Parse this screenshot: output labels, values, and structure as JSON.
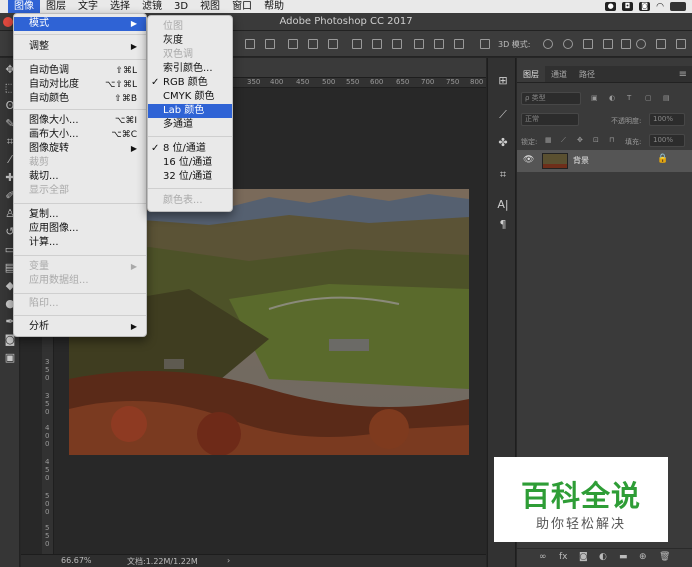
{
  "menubar": {
    "items": [
      "图像",
      "图层",
      "文字",
      "选择",
      "滤镜",
      "3D",
      "视图",
      "窗口",
      "帮助"
    ]
  },
  "window": {
    "title": "Adobe Photoshop CC 2017"
  },
  "options_bar": {
    "mode_label": "3D 模式:"
  },
  "image_menu": {
    "items": [
      {
        "label": "模式",
        "highlight": true,
        "submenu": true
      },
      {
        "label": "调整",
        "submenu": true
      },
      {
        "label": "自动色调",
        "shortcut": "⇧⌘L"
      },
      {
        "label": "自动对比度",
        "shortcut": "⌥⇧⌘L"
      },
      {
        "label": "自动颜色",
        "shortcut": "⇧⌘B"
      },
      {
        "label": "图像大小...",
        "shortcut": "⌥⌘I"
      },
      {
        "label": "画布大小...",
        "shortcut": "⌥⌘C"
      },
      {
        "label": "图像旋转",
        "submenu": true
      },
      {
        "label": "裁剪",
        "disabled": true
      },
      {
        "label": "裁切..."
      },
      {
        "label": "显示全部",
        "disabled": true
      },
      {
        "label": "复制..."
      },
      {
        "label": "应用图像..."
      },
      {
        "label": "计算..."
      },
      {
        "label": "变量",
        "disabled": true,
        "submenu": true
      },
      {
        "label": "应用数据组...",
        "disabled": true
      },
      {
        "label": "陷印...",
        "disabled": true
      },
      {
        "label": "分析",
        "submenu": true
      }
    ]
  },
  "mode_menu": {
    "items": [
      {
        "label": "位图",
        "disabled": true
      },
      {
        "label": "灰度"
      },
      {
        "label": "双色调",
        "disabled": true
      },
      {
        "label": "索引颜色..."
      },
      {
        "label": "RGB 颜色",
        "checked": true
      },
      {
        "label": "CMYK 颜色"
      },
      {
        "label": "Lab 颜色",
        "highlight": true
      },
      {
        "label": "多通道"
      },
      {
        "label": "8 位/通道",
        "checked": true
      },
      {
        "label": "16 位/通道"
      },
      {
        "label": "32 位/通道"
      },
      {
        "label": "颜色表...",
        "disabled": true
      }
    ]
  },
  "ruler": {
    "h_ticks": [
      "350",
      "400",
      "450",
      "500",
      "550",
      "600",
      "650",
      "700",
      "750",
      "800"
    ],
    "v_ticks": [
      "3",
      "5",
      "0",
      "3",
      "5",
      "0",
      "4",
      "0",
      "0",
      "4",
      "5",
      "0",
      "5",
      "0",
      "0",
      "5",
      "5",
      "0"
    ]
  },
  "status": {
    "zoom": "66.67%",
    "doc": "文档:1.22M/1.22M"
  },
  "layers_panel": {
    "tabs": [
      "图层",
      "通道",
      "路径"
    ],
    "filter_label": "ρ 类型",
    "blend_mode": "正常",
    "opacity_label": "不透明度:",
    "opacity_value": "100%",
    "lock_label": "锁定:",
    "fill_label": "填充:",
    "fill_value": "100%",
    "layer_name": "背景"
  },
  "watermark": {
    "title": "百科全说",
    "subtitle": "助你轻松解决"
  },
  "colors": {
    "menu_highlight": "#2f63d5",
    "watermark_green": "#2e9d36"
  }
}
